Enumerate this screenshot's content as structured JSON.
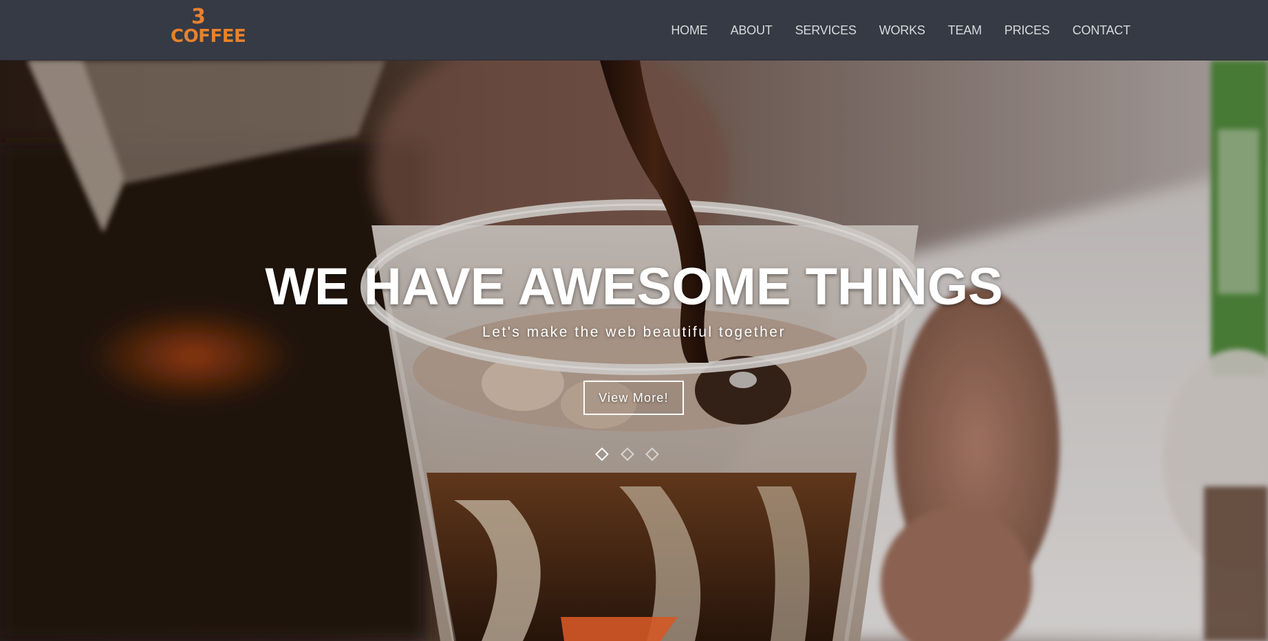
{
  "brand": {
    "logo_numeral": "3",
    "logo_wordmark": "COFFEE",
    "accent_color": "#e8822c"
  },
  "nav": {
    "items": [
      {
        "label": "HOME"
      },
      {
        "label": "ABOUT"
      },
      {
        "label": "SERVICES"
      },
      {
        "label": "WORKS"
      },
      {
        "label": "TEAM"
      },
      {
        "label": "PRICES"
      },
      {
        "label": "CONTACT"
      }
    ],
    "background_color": "#363a45",
    "text_color": "#d8d9dc"
  },
  "hero": {
    "title": "WE HAVE AWESOME THINGS",
    "subtitle": "Let's make the web beautiful together",
    "button_label": "View More!",
    "background": "photo of iced coffee being poured into a clear plastic cup",
    "carousel": {
      "slide_count": 3,
      "active_index": 0
    }
  }
}
